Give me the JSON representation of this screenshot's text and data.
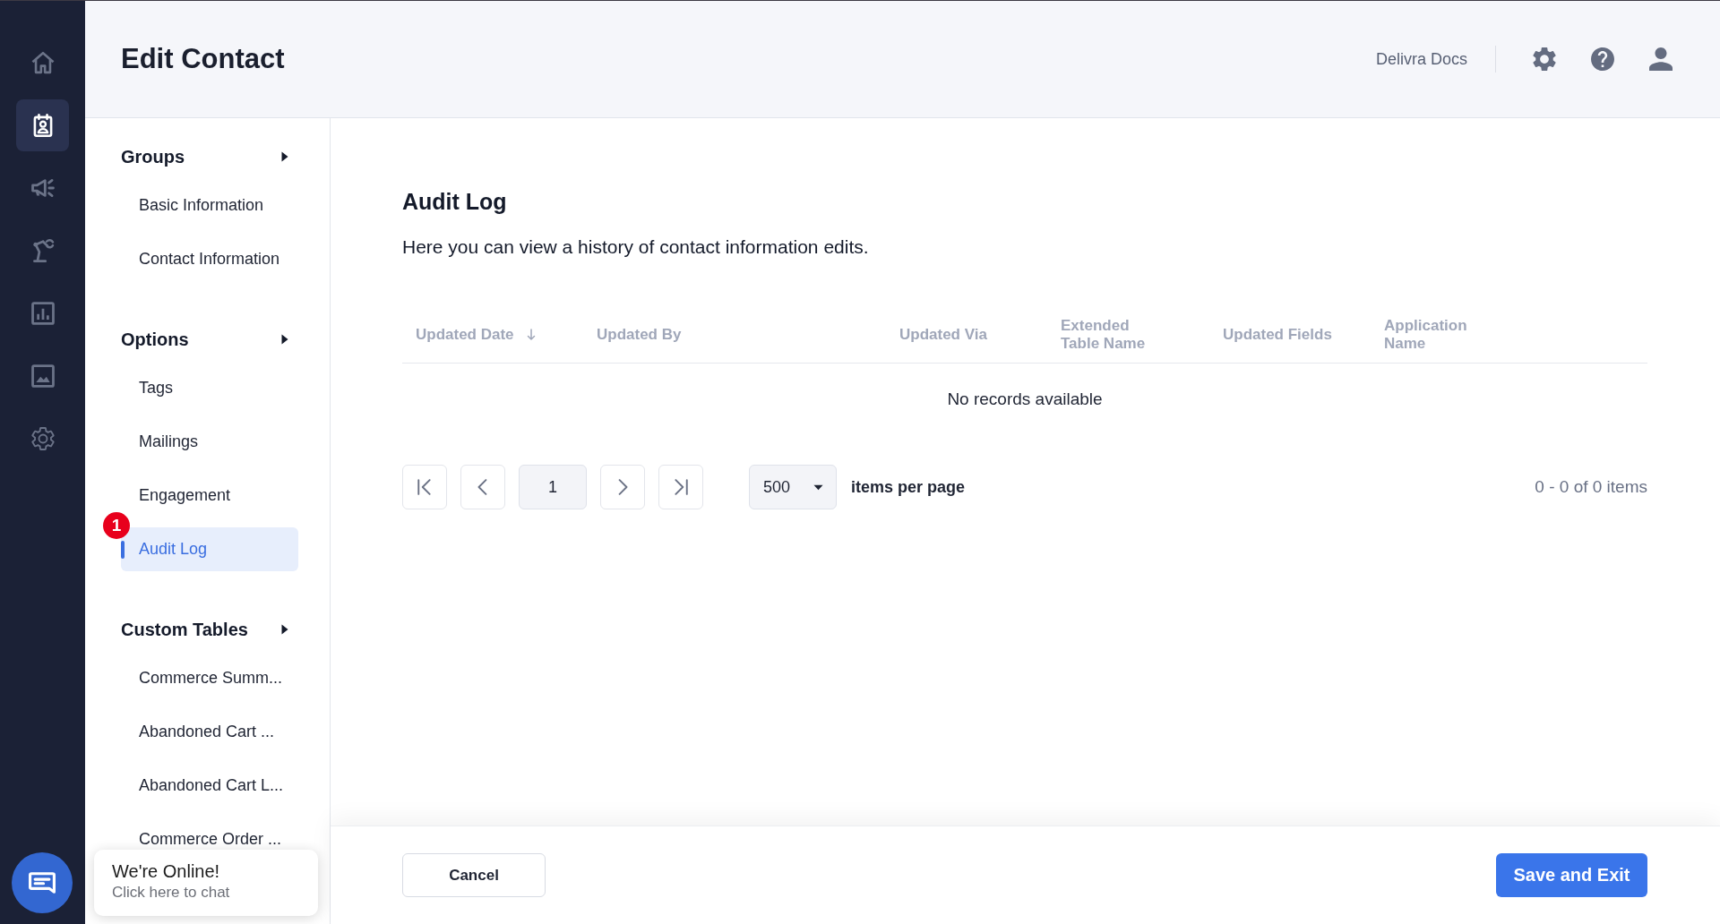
{
  "nav_rail": {
    "items": [
      {
        "selected": false
      },
      {
        "selected": true
      },
      {
        "selected": false
      },
      {
        "selected": false
      },
      {
        "selected": false
      },
      {
        "selected": false
      },
      {
        "selected": false
      }
    ]
  },
  "header": {
    "title": "Edit Contact",
    "docs_link": "Delivra Docs"
  },
  "sidebar": {
    "sections": [
      {
        "title": "Groups",
        "items": [
          {
            "label": "Basic Information",
            "selected": false
          },
          {
            "label": "Contact Information",
            "selected": false
          }
        ]
      },
      {
        "title": "Options",
        "items": [
          {
            "label": "Tags",
            "selected": false
          },
          {
            "label": "Mailings",
            "selected": false
          },
          {
            "label": "Engagement",
            "selected": false
          },
          {
            "label": "Audit Log",
            "selected": true,
            "badge": "1"
          }
        ]
      },
      {
        "title": "Custom Tables",
        "items": [
          {
            "label": "Commerce Summ...",
            "selected": false
          },
          {
            "label": "Abandoned Cart ...",
            "selected": false
          },
          {
            "label": "Abandoned Cart L...",
            "selected": false
          },
          {
            "label": "Commerce Order ...",
            "selected": false
          }
        ]
      }
    ]
  },
  "audit_log": {
    "title": "Audit Log",
    "description": "Here you can view a history of contact information edits.",
    "table": {
      "columns": [
        {
          "label": "Updated Date",
          "sorted": true
        },
        {
          "label": "Updated By",
          "sorted": false
        },
        {
          "label": "Updated Via",
          "sorted": false
        },
        {
          "label": "Extended Table Name",
          "sorted": false
        },
        {
          "label": "Updated Fields",
          "sorted": false
        },
        {
          "label": "Application Name",
          "sorted": false
        }
      ],
      "empty_message": "No records available"
    },
    "pagination": {
      "current_page": "1",
      "page_size": "500",
      "page_size_label": "items per page",
      "summary": "0 - 0 of 0 items"
    }
  },
  "footer": {
    "buttons": [
      {
        "label": "Cancel",
        "kind": "secondary"
      },
      {
        "label": "Save and Exit",
        "kind": "primary"
      }
    ]
  },
  "chat_widget": {
    "title": "We're Online!",
    "subtitle": "Click here to chat"
  }
}
